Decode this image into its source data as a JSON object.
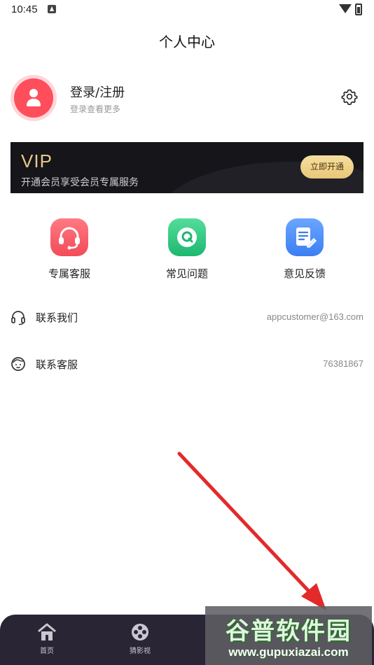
{
  "status_bar": {
    "time": "10:45"
  },
  "header": {
    "title": "个人中心"
  },
  "profile": {
    "title": "登录/注册",
    "subtitle": "登录查看更多"
  },
  "vip": {
    "title": "VIP",
    "subtitle": "开通会员享受会员专属服务",
    "button_label": "立即开通"
  },
  "quick_actions": [
    {
      "label": "专属客服",
      "icon": "headset-icon",
      "color": "#f24b58"
    },
    {
      "label": "常见问题",
      "icon": "faq-q-icon",
      "color": "#1db870"
    },
    {
      "label": "意见反馈",
      "icon": "feedback-icon",
      "color": "#3b7ef3"
    }
  ],
  "list": [
    {
      "label": "联系我们",
      "value": "appcustomer@163.com",
      "icon": "headphones-icon"
    },
    {
      "label": "联系客服",
      "value": "76381867",
      "icon": "service-agent-icon"
    }
  ],
  "tabs": [
    {
      "label": "首页",
      "icon": "home-icon"
    },
    {
      "label": "猜影视",
      "icon": "film-reel-icon"
    }
  ],
  "watermark": {
    "title": "谷普软件园",
    "url": "www.gupuxiazai.com"
  },
  "colors": {
    "accent_red": "#ff4e5b",
    "vip_gold": "#e9c98a",
    "tabbar": "#2a2535",
    "arrow": "#e32a2a"
  }
}
